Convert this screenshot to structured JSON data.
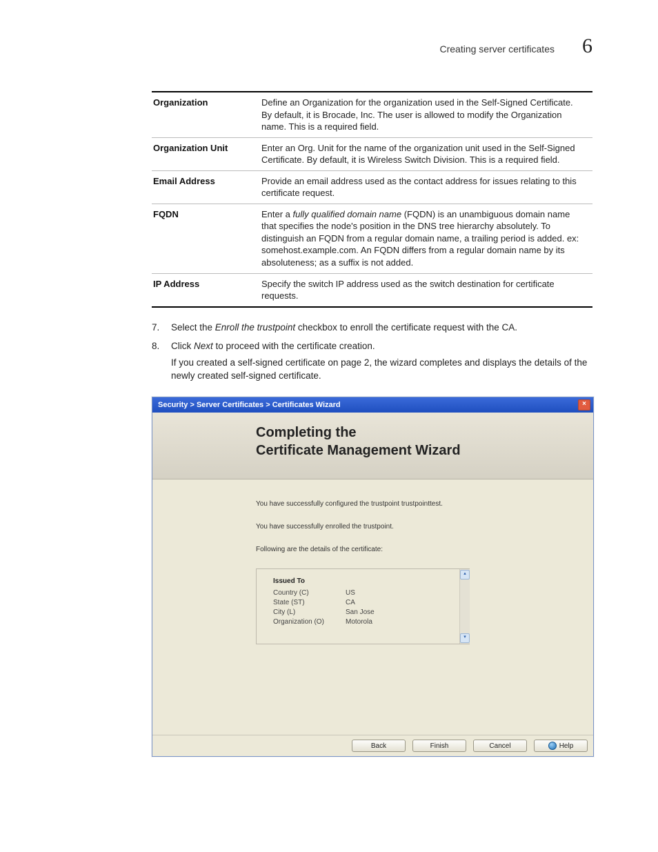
{
  "header": {
    "title": "Creating server certificates",
    "chapter_number": "6"
  },
  "definitions": [
    {
      "term": "Organization",
      "desc": "Define an Organization for the organization used in the Self-Signed Certificate. By default, it is Brocade, Inc. The user is allowed to modify the Organization name. This is a required field."
    },
    {
      "term": "Organization Unit",
      "desc": "Enter an Org. Unit for the name of the organization unit used in the Self-Signed Certificate. By default, it is Wireless Switch Division. This is a required field."
    },
    {
      "term": "Email Address",
      "desc": "Provide an email address used as the contact address for issues relating to this certificate request."
    },
    {
      "term": "FQDN",
      "desc_pre": "Enter a ",
      "desc_em": "fully qualified domain name",
      "desc_post": " (FQDN) is an unambiguous domain name that specifies the node's position in the DNS tree hierarchy absolutely. To distinguish an FQDN from a regular domain name, a trailing period is added. ex: somehost.example.com. An FQDN differs from a regular domain name by its absoluteness; as a suffix is not added."
    },
    {
      "term": "IP Address",
      "desc": "Specify the switch IP address used as the switch destination for certificate requests."
    }
  ],
  "steps": {
    "s7": {
      "num": "7.",
      "pre": "Select the ",
      "em": "Enroll the trustpoint",
      "post": " checkbox to enroll the certificate request with the CA."
    },
    "s8": {
      "num": "8.",
      "pre": "Click ",
      "em": "Next",
      "post": " to proceed with the certificate creation."
    },
    "continuation": "If you created a self-signed certificate on page 2, the wizard completes and displays the details of the newly created self-signed certificate."
  },
  "wizard": {
    "breadcrumb": "Security > Server Certificates > Certificates Wizard",
    "heading_line1": "Completing the",
    "heading_line2": "Certificate Management Wizard",
    "msg_configured": "You have successfully configured the trustpoint trustpointtest.",
    "msg_enrolled": "You have successfully enrolled the trustpoint.",
    "msg_details": "Following are the details of the certificate:",
    "issued_to_header": "Issued To",
    "details": {
      "country": {
        "k": "Country (C)",
        "v": "US"
      },
      "state": {
        "k": "State (ST)",
        "v": "CA"
      },
      "city": {
        "k": "City (L)",
        "v": "San Jose"
      },
      "org": {
        "k": "Organization (O)",
        "v": "Motorola"
      }
    },
    "buttons": {
      "back": "Back",
      "finish": "Finish",
      "cancel": "Cancel",
      "help": "Help"
    }
  }
}
